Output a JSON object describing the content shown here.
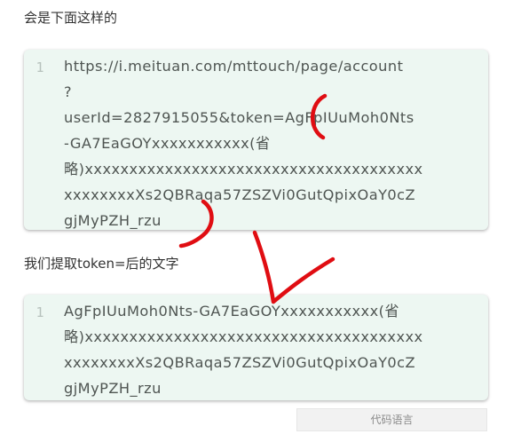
{
  "intro_text": "会是下面这样的",
  "url_block": {
    "line_number": "1",
    "lines": [
      "https://i.meituan.com/mttouch/page/account",
      "?",
      "userId=2827915055&token=AgFpIUuMoh0Nts",
      "-GA7EaGOYxxxxxxxxxxx(省",
      "略)xxxxxxxxxxxxxxxxxxxxxxxxxxxxxxxxxxxxxx",
      "xxxxxxxxXs2QBRaqa57ZSZVi0GutQpixOaY0cZ",
      "gjMyPZH_rzu"
    ]
  },
  "extract_text": "我们提取token=后的文字",
  "token_block": {
    "line_number": "1",
    "lines": [
      "AgFpIUuMoh0Nts-GA7EaGOYxxxxxxxxxxx(省",
      "略)xxxxxxxxxxxxxxxxxxxxxxxxxxxxxxxxxxxxxx",
      "xxxxxxxxXs2QBRaqa57ZSZVi0GutQpixOaY0cZ",
      "gjMyPZH_rzu"
    ]
  },
  "language_button": "代码语言",
  "colors": {
    "code_background": "#edf7f2",
    "annotation_red": "#e00d12",
    "button_background": "#f2f2f2"
  }
}
